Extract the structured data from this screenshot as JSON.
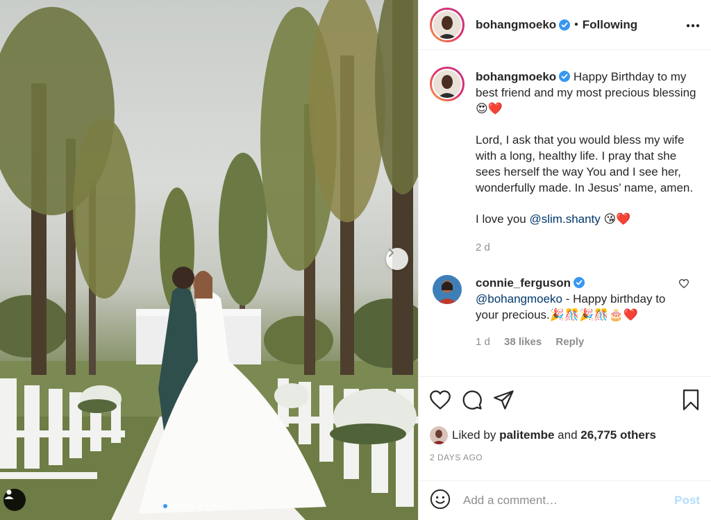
{
  "post": {
    "author": "bohangmoeko",
    "follow_separator": "•",
    "follow_status": "Following",
    "caption": {
      "line1": "Happy Birthday to my best friend and my most precious blessing 😍❤️",
      "line2": "Lord, I ask that you would bless my wife with a long, healthy life. I pray that she sees herself the way You and I see her, wonderfully made. In Jesus’ name, amen.",
      "line3_prefix": "I love you ",
      "line3_mention": "@slim.shanty",
      "line3_suffix": " 😘❤️"
    },
    "caption_age": "2 d",
    "photo_count_dots": 9,
    "active_dot": 0
  },
  "comments": [
    {
      "username": "connie_ferguson",
      "mention": "@bohangmoeko",
      "text": " - Happy birthday to your precious.🎉🎊🎉🎊🎂❤️",
      "age": "1 d",
      "likes": "38 likes",
      "reply": "Reply"
    }
  ],
  "likes": {
    "prefix": "Liked by ",
    "user": "palitembe",
    "middle": " and ",
    "others": "26,775 others"
  },
  "date_label": "2 DAYS AGO",
  "add_comment": {
    "placeholder": "Add a comment…",
    "post_label": "Post"
  },
  "icons": {
    "verified": "verified-badge-icon",
    "more": "more-options-icon",
    "like": "heart-icon",
    "comment": "comment-bubble-icon",
    "share": "paper-plane-icon",
    "save": "bookmark-icon",
    "emoji": "smiley-icon",
    "next": "chevron-right-icon",
    "tag": "user-tag-icon"
  },
  "colors": {
    "verified_blue": "#3897f0",
    "mention_blue": "#00376b",
    "post_disabled": "#b2dffc",
    "meta_gray": "#8e8e8e"
  }
}
